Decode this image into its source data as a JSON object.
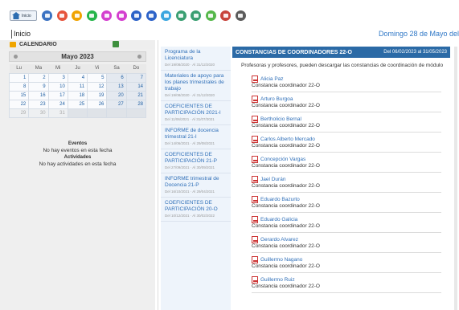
{
  "nav": {
    "home_label": "Inicio",
    "icons": [
      {
        "name": "home-icon",
        "color": "#3b72c2"
      },
      {
        "name": "survey-icon",
        "color": "#e6543c"
      },
      {
        "name": "dollar-icon",
        "color": "#f0a300"
      },
      {
        "name": "shapes-icon",
        "color": "#25b54a"
      },
      {
        "name": "cancel-icon",
        "color": "#d43fcf"
      },
      {
        "name": "chat-icon",
        "color": "#d43fcf"
      },
      {
        "name": "document-icon",
        "color": "#2d63c8"
      },
      {
        "name": "monitor-icon",
        "color": "#2d63c8"
      },
      {
        "name": "contacts-icon",
        "color": "#3aa6df"
      },
      {
        "name": "tablet-icon",
        "color": "#3a9f72"
      },
      {
        "name": "cloud-icon",
        "color": "#3a9f72"
      },
      {
        "name": "users-icon",
        "color": "#55b84a"
      },
      {
        "name": "profile-icon",
        "color": "#c8443c"
      },
      {
        "name": "settings-icon",
        "color": "#5b5b5b"
      }
    ]
  },
  "breadcrumb": "Inicio",
  "date_text": "Domingo 28 de Mayo del",
  "calendar": {
    "title": "CALENDARIO",
    "month": "Mayo 2023",
    "weekdays": [
      "Lu",
      "Ma",
      "Mi",
      "Ju",
      "Vi",
      "Sa",
      "Do"
    ],
    "weeks": [
      [
        "1",
        "2",
        "3",
        "4",
        "5",
        "6",
        "7"
      ],
      [
        "8",
        "9",
        "10",
        "11",
        "12",
        "13",
        "14"
      ],
      [
        "15",
        "16",
        "17",
        "18",
        "19",
        "20",
        "21"
      ],
      [
        "22",
        "23",
        "24",
        "25",
        "26",
        "27",
        "28"
      ],
      [
        "29",
        "30",
        "31",
        "",
        "",
        "",
        ""
      ]
    ]
  },
  "events": {
    "events_title": "Eventos",
    "events_text": "No hay eventos en esta fecha",
    "activities_title": "Actividades",
    "activities_text": "No hay actividades en esta fecha"
  },
  "news": [
    {
      "title": "Programa de la Licenciatura",
      "date": "Del 19/08/2020 · Al 31/12/2020"
    },
    {
      "title": "Materiales de apoyo para los planes trimestrales de trabajo",
      "date": "Del 19/08/2020 · Al 31/12/2020"
    },
    {
      "title": "COEFICIENTES DE PARTICIPACIÓN 2021-I",
      "date": "Del 11/06/2021 · Al 31/07/2021"
    },
    {
      "title": "INFORME de docencia trimestral 21-I",
      "date": "Del 14/06/2021 · Al 29/08/2021"
    },
    {
      "title": "COEFICIENTES DE PARTICIPACIÓN 21-P",
      "date": "Del 27/09/2021 · Al 30/09/2021"
    },
    {
      "title": "INFORME trimestral de Docencia 21-P",
      "date": "Del 16/10/2021 · Al 29/04/2021"
    },
    {
      "title": "COEFICIENTES DE PARTICIPACIÓN 20-O",
      "date": "Del 10/12/2021 · Al 30/02/2022"
    }
  ],
  "main": {
    "title": "CONSTANCIAS DE COORDINADORES 22-O",
    "range": "Del 06/02/2023 al 31/05/2023",
    "description": "Profesoras y profesores, pueden descargar las constancias de coordinación de módulo",
    "docs": [
      {
        "name": "Alicia Paz",
        "sub": "Constancia coordinador 22-O"
      },
      {
        "name": "Arturo Burgoa",
        "sub": "Constancia coordinador 22-O"
      },
      {
        "name": "Bertholicio Bernal",
        "sub": "Constancia coordinador 22-O"
      },
      {
        "name": "Carlos Alberto Mercado",
        "sub": "Constancia coordinador 22-O"
      },
      {
        "name": "Concepción Vargas",
        "sub": "Constancia coordinador 22-O"
      },
      {
        "name": "Jael Durán",
        "sub": "Constancia coordinador 22-O"
      },
      {
        "name": "Eduardo Bazurto",
        "sub": "Constancia coordinador 22-O"
      },
      {
        "name": "Eduardo Galicia",
        "sub": "Constancia coordinador 22-O"
      },
      {
        "name": "Gerardo Alvarez",
        "sub": "Constancia coordinador 22-O"
      },
      {
        "name": "Guillermo Nagano",
        "sub": "Constancia coordinador 22-O"
      },
      {
        "name": "Guillermo Ruiz",
        "sub": "Constancia coordinador 22-O"
      }
    ]
  }
}
